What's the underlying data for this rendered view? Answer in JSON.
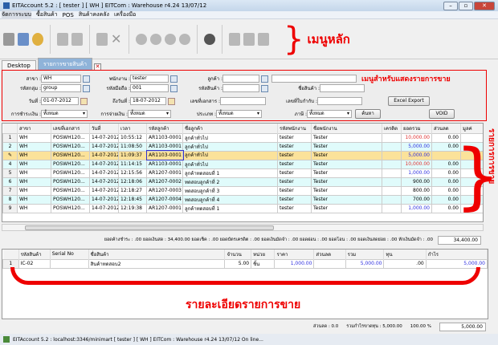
{
  "window": {
    "title": "EITAccount  5.2 : [ tester ] [ WH ]    EITCom : Warehouse    r4.24 13/07/12"
  },
  "menu": [
    "จัดการระบบ",
    "ซื้อสินค้า",
    "POS",
    "สินค้าคงคลัง",
    "เครื่องมือ"
  ],
  "annotations": {
    "main_menu": "เมนูหลัก",
    "filter_menu": "เมนูสำหรับแสดงรายการขาย",
    "list": "รายการการขาย",
    "detail": "รายละเอียดรายการขาย"
  },
  "tabs": [
    {
      "label": "Desktop"
    },
    {
      "label": "รายการขายสินค้า"
    }
  ],
  "filters": {
    "branch_label": "สาขา :",
    "branch": "WH",
    "employee_label": "พนักงาน :",
    "employee": "tester",
    "customer_label": "ลูกค้า :",
    "customer": "",
    "customer_name": "",
    "group_label": "รหัสกลุ่ม :",
    "group": "group",
    "machine_label": "รหัสมือถือ :",
    "machine": "001",
    "product_code_label": "รหัสสินค้า :",
    "product_code": "",
    "product_name_label": "ชื่อสินค้า :",
    "product_name": "",
    "date_label": "วันที่ :",
    "date_from": "01-07-2012",
    "date_to_label": "ถึงวันที่ :",
    "date_to": "18-07-2012",
    "doc_no_label": "เลขที่เอกสาร :",
    "doc_no": "",
    "invoice_label": "เลขที่ใบกำกับ :",
    "invoice": "",
    "pay_status_label": "การชำระเงิน :",
    "pay_status": "ทั้งหมด",
    "pay_type_label": "การจ่ายเงิน :",
    "pay_type": "ทั้งหมด",
    "type_label": "ประเภท :",
    "type": "ทั้งหมด",
    "tax_label": "ภาษี :",
    "tax": "ทั้งหมด",
    "search_button": "ค้นหา",
    "excel_button": "Excel Export",
    "void_button": "VOID"
  },
  "grid": {
    "columns": [
      "",
      "สาขา",
      "เลขที่เอกสาร",
      "วันที่",
      "เวลา",
      "รหัสลูกค้า",
      "ชื่อลูกค้า",
      "รหัสพนักงาน",
      "ชื่อพนักงาน",
      "เครดิต",
      "ยอดรวม",
      "ส่วนลด",
      "มูลค่"
    ],
    "rows": [
      [
        "1",
        "WH",
        "POSWH120...",
        "14-07-2012",
        "10:55:12",
        "AR1103-0001",
        "ลูกค้าทั่วไป",
        "tester",
        "Tester",
        "",
        "10,000.00",
        "0.00",
        ""
      ],
      [
        "2",
        "WH",
        "POSWH120...",
        "14-07-2012",
        "11:08:50",
        "AR1103-0001",
        "ลูกค้าทั่วไป",
        "tester",
        "Tester",
        "",
        "5,000.00",
        "0.00",
        ""
      ],
      [
        "✎",
        "WH",
        "POSWH120...",
        "14-07-2012",
        "11:09:37",
        "AR1103-0001",
        "ลูกค้าทั่วไป",
        "tester",
        "Tester",
        "",
        "5,000.00",
        "",
        ""
      ],
      [
        "4",
        "WH",
        "POSWH120...",
        "14-07-2012",
        "11:14:15",
        "AR1103-0001",
        "ลูกค้าทั่วไป",
        "tester",
        "Tester",
        "",
        "10,000.00",
        "0.00",
        ""
      ],
      [
        "5",
        "WH",
        "POSWH120...",
        "14-07-2012",
        "12:15:56",
        "AR1207-0001",
        "ลูกค้าทดสอบที่ 1",
        "tester",
        "Tester",
        "",
        "1,000.00",
        "0.00",
        ""
      ],
      [
        "6",
        "WH",
        "POSWH120...",
        "14-07-2012",
        "12:18:06",
        "AR1207-0002",
        "ทดสอบลูกค้าที่ 2",
        "tester",
        "Tester",
        "",
        "900.00",
        "0.00",
        ""
      ],
      [
        "7",
        "WH",
        "POSWH120...",
        "14-07-2012",
        "12:18:27",
        "AR1207-0003",
        "ทดสอบลูกค้าที่ 3",
        "tester",
        "Tester",
        "",
        "800.00",
        "0.00",
        ""
      ],
      [
        "8",
        "WH",
        "POSWH120...",
        "14-07-2012",
        "12:18:45",
        "AR1207-0004",
        "ทดสอบลูกค้าที่ 4",
        "tester",
        "Tester",
        "",
        "700.00",
        "0.00",
        ""
      ],
      [
        "9",
        "WH",
        "POSWH120...",
        "14-07-2012",
        "12:19:38",
        "AR1207-0001",
        "ลูกค้าทดสอบที่ 1",
        "tester",
        "Tester",
        "",
        "1,000.00",
        "0.00",
        ""
      ]
    ],
    "amount_colors": [
      "#e03030",
      "#3030e0",
      "#3030e0",
      "#e03030",
      "#3030e0",
      "#000000",
      "#000000",
      "#000000",
      "#3030e0"
    ]
  },
  "summary": {
    "text": "ยอดค้างชำระ : .00  ยอดเงินสด : 34,400.00  ยอดเช็ค : .00  ยอดบัตรเครดิต : .00  ยอดเงินมัดจำ : .00  ยอดผ่อน : .00  ยอดโอน : .00  ยอดเงินสดย่อย : .00  หักเงินมัดจำ : .00",
    "total": "34,400.00"
  },
  "detail": {
    "columns": [
      "",
      "รหัสสินค้า",
      "Serial No",
      "ชื่อสินค้า",
      "จำนวน",
      "หน่วย",
      "ราคา",
      "ส่วนลด",
      "รวม",
      "ทุน",
      "กำไร"
    ],
    "rows": [
      [
        "1",
        "IC-02",
        "",
        "สินค้าทดสอบ2",
        "5.00",
        "ชิ้น",
        "1,000.00",
        "",
        "5,000.00",
        ".00",
        "5,000.00"
      ]
    ]
  },
  "bottom": {
    "discount": "ส่วนลด :  0.0",
    "profit": "รวมกำไรขาดทุน : 5,000.00",
    "percent": "100.00 %",
    "total": "5,000.00"
  },
  "status": {
    "text": "EITAccount   5.2 : localhost:3346/minimart  [ tester ] [ WH ]    EITCom : Warehouse    r4.24 13/07/12  On line..."
  }
}
